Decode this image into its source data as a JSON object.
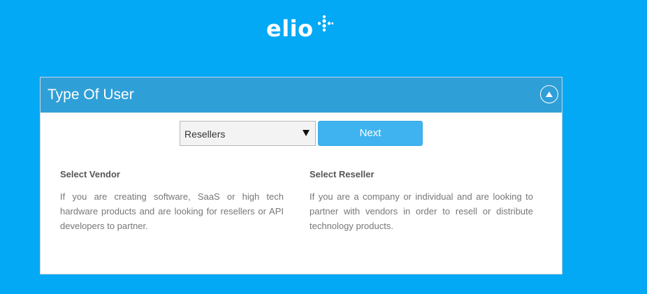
{
  "logo": {
    "text": "elio"
  },
  "panel": {
    "title": "Type Of User",
    "select": {
      "value": "Resellers"
    },
    "next_label": "Next"
  },
  "options": [
    {
      "heading": "Select Vendor",
      "description": "If you are creating software, SaaS or high tech hardware products and are looking for resellers or API developers to partner."
    },
    {
      "heading": "Select Reseller",
      "description": "If you are a company or individual and are looking to partner with vendors in order to resell or distribute technology products."
    }
  ],
  "colors": {
    "background": "#03a9f4",
    "header": "#2f9fd8",
    "button": "#3fb3ef"
  },
  "icons": {
    "logo_mark": "sparkle-plus-icon",
    "collapse": "chevron-up-circle-icon",
    "dropdown": "triangle-down-icon"
  }
}
